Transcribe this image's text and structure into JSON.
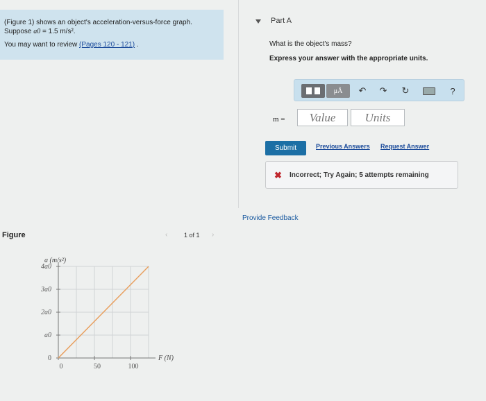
{
  "problem": {
    "line1": "(Figure 1) shows an object's acceleration-versus-force graph.",
    "suppose_prefix": "Suppose ",
    "suppose_symbol": "a0",
    "suppose_value": " = 1.5 m/s².",
    "review_prefix": "You may want to review ",
    "review_link": "(Pages 120 - 121)",
    "review_suffix": " ."
  },
  "part": {
    "title": "Part A",
    "question": "What is the object's mass?",
    "instruction": "Express your answer with the appropriate units."
  },
  "toolbar": {
    "mu_label": "μÅ",
    "undo_icon": "↶",
    "redo_icon": "↷",
    "reset_icon": "↻",
    "help_label": "?"
  },
  "answer": {
    "variable": "m =",
    "value_placeholder": "Value",
    "units_placeholder": "Units"
  },
  "actions": {
    "submit": "Submit",
    "previous_answers": "Previous Answers",
    "request_answer": "Request Answer"
  },
  "feedback": {
    "icon": "✖",
    "message": "Incorrect; Try Again; 5 attempts remaining"
  },
  "provide_feedback": "Provide Feedback",
  "figure": {
    "heading": "Figure",
    "pager": "1 of 1",
    "prev_icon": "‹",
    "next_icon": "›"
  },
  "chart_data": {
    "type": "line",
    "ylabel": "a (m/s²)",
    "xlabel": "F (N)",
    "x_ticks": [
      "0",
      "50",
      "100"
    ],
    "y_ticks": [
      "0",
      "a0",
      "2a0",
      "3a0",
      "4a0"
    ],
    "xlim": [
      0,
      125
    ],
    "ylim": [
      0,
      4
    ],
    "series": [
      {
        "x": [
          0,
          125
        ],
        "y": [
          0,
          4
        ]
      }
    ],
    "line_color": "#e8a060",
    "grid": true
  }
}
